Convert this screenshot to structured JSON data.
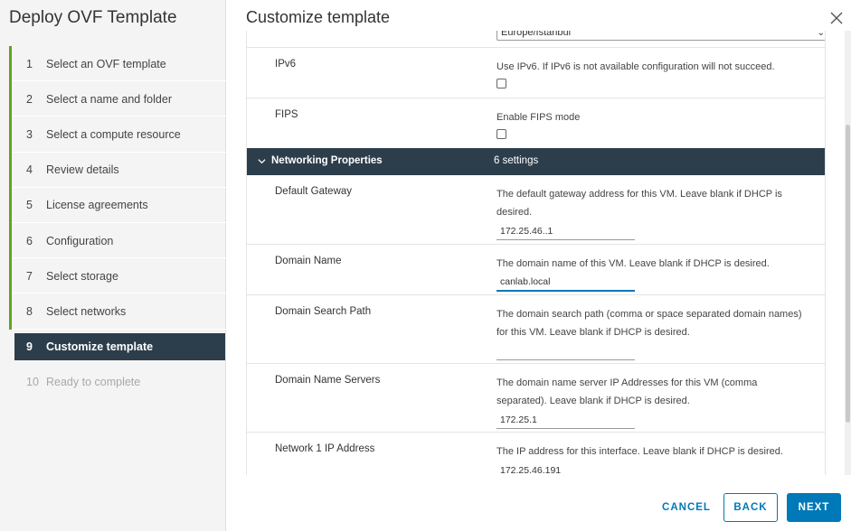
{
  "wizard": {
    "title": "Deploy OVF Template",
    "steps": [
      {
        "num": "1",
        "label": "Select an OVF template",
        "state": "done"
      },
      {
        "num": "2",
        "label": "Select a name and folder",
        "state": "done"
      },
      {
        "num": "3",
        "label": "Select a compute resource",
        "state": "done"
      },
      {
        "num": "4",
        "label": "Review details",
        "state": "done"
      },
      {
        "num": "5",
        "label": "License agreements",
        "state": "done"
      },
      {
        "num": "6",
        "label": "Configuration",
        "state": "done"
      },
      {
        "num": "7",
        "label": "Select storage",
        "state": "done"
      },
      {
        "num": "8",
        "label": "Select networks",
        "state": "done"
      },
      {
        "num": "9",
        "label": "Customize template",
        "state": "active"
      },
      {
        "num": "10",
        "label": "Ready to complete",
        "state": "disabled"
      }
    ]
  },
  "main": {
    "title": "Customize template",
    "timezone_value": "Europe/Istanbul",
    "ipv6": {
      "label": "IPv6",
      "desc": "Use IPv6. If IPv6 is not available configuration will not succeed."
    },
    "fips": {
      "label": "FIPS",
      "desc": "Enable FIPS mode"
    },
    "networking": {
      "title": "Networking Properties",
      "count": "6 settings"
    },
    "gateway": {
      "label": "Default Gateway",
      "desc": "The default gateway address for this VM. Leave blank if DHCP is desired.",
      "value": "172.25.46..1"
    },
    "domain": {
      "label": "Domain Name",
      "desc": "The domain name of this VM. Leave blank if DHCP is desired.",
      "value": "canlab.local"
    },
    "search_path": {
      "label": "Domain Search Path",
      "desc": "The domain search path (comma or space separated domain names) for this VM. Leave blank if DHCP is desired.",
      "value": ""
    },
    "dns": {
      "label": "Domain Name Servers",
      "desc": "The domain name server IP Addresses for this VM (comma separated). Leave blank if DHCP is desired.",
      "value": "172.25.1"
    },
    "ip": {
      "label": "Network 1 IP Address",
      "desc": "The IP address for this interface. Leave blank if DHCP is desired.",
      "value": "172.25.46.191"
    }
  },
  "footer": {
    "cancel": "CANCEL",
    "back": "BACK",
    "next": "NEXT"
  },
  "colors": {
    "accent": "#0079b8",
    "header_bg": "#2c3e4b",
    "done_bar": "#62a420"
  }
}
